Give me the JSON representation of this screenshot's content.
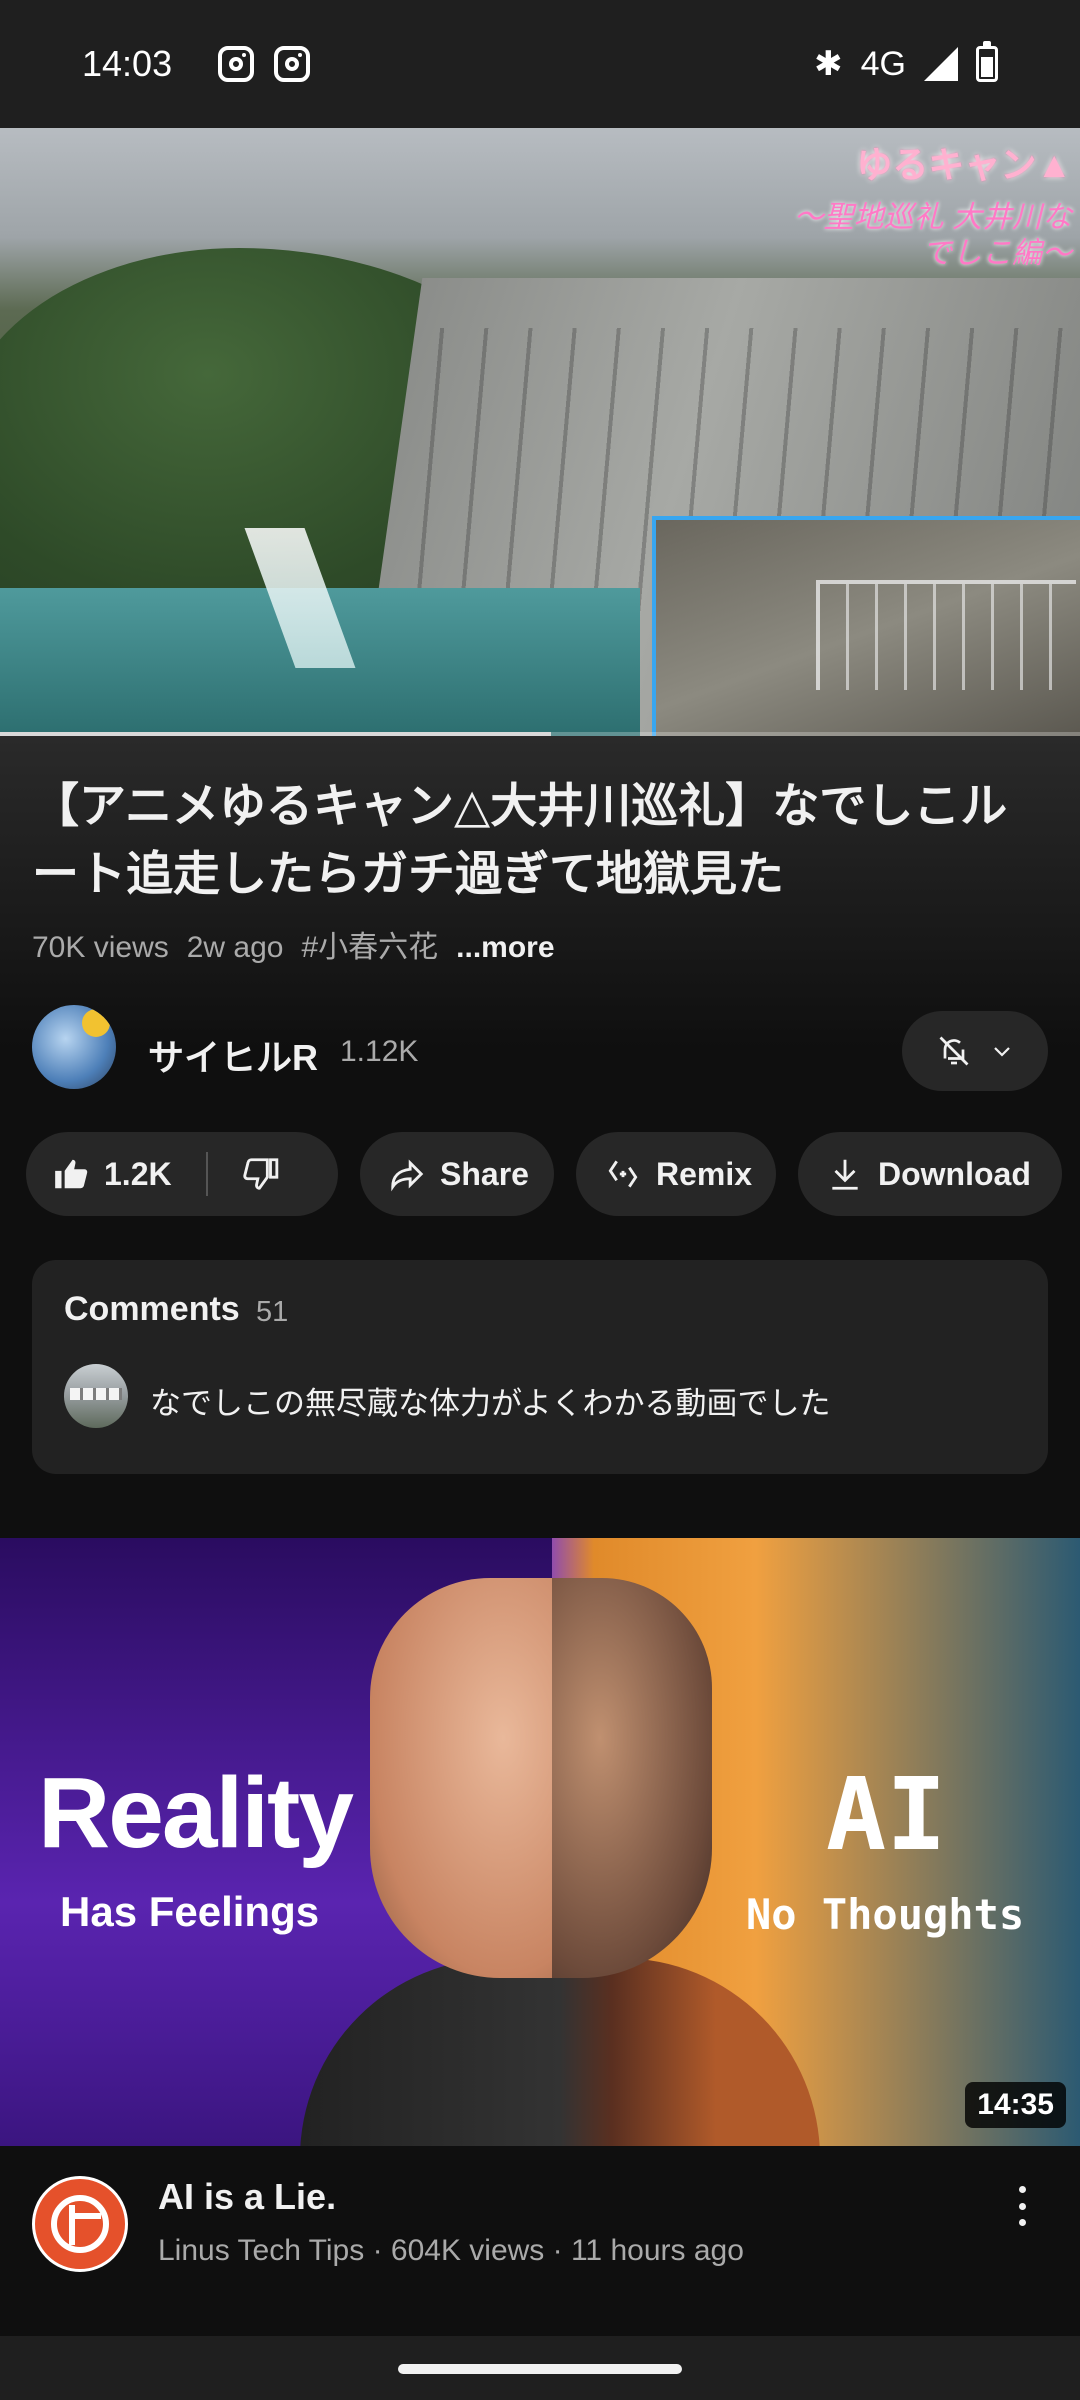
{
  "status_bar": {
    "time": "14:03",
    "network": "4G",
    "icons": [
      "instagram-icon",
      "instagram-icon",
      "bluetooth-icon",
      "signal-icon",
      "battery-icon"
    ]
  },
  "player": {
    "overlay_logo": "ゆるキャン▲",
    "overlay_caption": "〜聖地巡礼 大井川なでしこ編〜",
    "progress_fraction": 0.51
  },
  "video": {
    "title": "【アニメゆるキャン△大井川巡礼】なでしこルート追走したらガチ過ぎて地獄見た",
    "views": "70K views",
    "age": "2w ago",
    "hashtag": "#小春六花",
    "more_label": "...more"
  },
  "channel": {
    "name": "サイヒルR",
    "subscribers": "1.12K"
  },
  "actions": {
    "like_count": "1.2K",
    "share_label": "Share",
    "remix_label": "Remix",
    "download_label": "Download"
  },
  "comments": {
    "heading": "Comments",
    "count": "51",
    "top_comment": "なでしこの無尽蔵な体力がよくわかる動画でした"
  },
  "next_video": {
    "thumb_left_word": "Reality",
    "thumb_left_sub": "Has Feelings",
    "thumb_right_word": "AI",
    "thumb_right_sub": "No Thoughts",
    "duration": "14:35",
    "title": "AI is a Lie.",
    "meta": "Linus Tech Tips · 604K views · 11 hours ago"
  },
  "colors": {
    "background": "#0f0f0f",
    "pill": "#272727",
    "card": "#222222",
    "secondary_text": "#aaaaaa",
    "inset_border": "#38a6f0"
  }
}
